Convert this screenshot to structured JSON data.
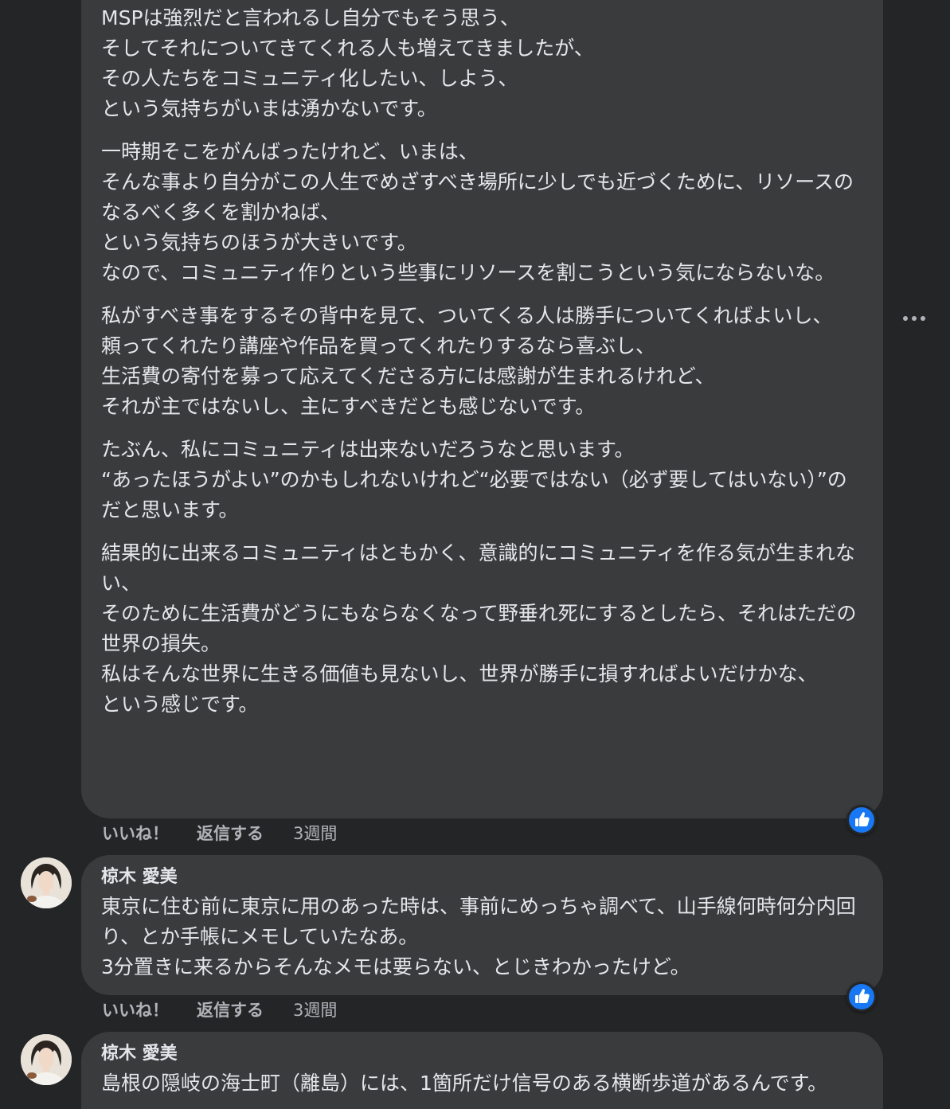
{
  "comments": [
    {
      "paragraphs": [
        "MSPは強烈だと言われるし自分でもそう思う、\nそしてそれについてきてくれる人も増えてきましたが、\nその人たちをコミュニティ化したい、しよう、\nという気持ちがいまは湧かないです。",
        "一時期そこをがんばったけれど、いまは、\nそんな事より自分がこの人生でめざすべき場所に少しでも近づくために、リソースのなるべく多くを割かねば、\nという気持ちのほうが大きいです。\nなので、コミュニティ作りという些事にリソースを割こうという気にならないな。",
        "私がすべき事をするその背中を見て、ついてくる人は勝手についてくればよいし、\n頼ってくれたり講座や作品を買ってくれたりするなら喜ぶし、\n生活費の寄付を募って応えてくださる方には感謝が生まれるけれど、\nそれが主ではないし、主にすべきだとも感じないです。",
        "たぶん、私にコミュニティは出来ないだろうなと思います。\n“あったほうがよい”のかもしれないけれど“必要ではない（必ず要してはいない）”のだと思います。",
        "結果的に出来るコミュニティはともかく、意識的にコミュニティを作る気が生まれない、\nそのために生活費がどうにもならなくなって野垂れ死にするとしたら、それはただの世界の損失。\n私はそんな世界に生きる価値も見ないし、世界が勝手に損すればよいだけかな、\nという感じです。"
      ],
      "like_label": "いいね！",
      "reply_label": "返信する",
      "time": "3週間"
    },
    {
      "author": "椋木 愛美",
      "text": "東京に住む前に東京に用のあった時は、事前にめっちゃ調べて、山手線何時何分内回り、とか手帳にメモしていたなあ。\n3分置きに来るからそんなメモは要らない、とじきわかったけど。",
      "like_label": "いいね！",
      "reply_label": "返信する",
      "time": "3週間"
    },
    {
      "author": "椋木 愛美",
      "text": "島根の隠岐の海士町（離島）には、1箇所だけ信号のある横断歩道があるんです。"
    }
  ],
  "icons": {
    "reaction": "like-thumb-icon",
    "menu": "more-options-icon",
    "avatar": "user-avatar"
  },
  "colors": {
    "background": "#242526",
    "bubble": "#3a3b3c",
    "text": "#e4e6eb",
    "secondary_text": "#b0b3b8",
    "like_blue": "#1877f2"
  }
}
